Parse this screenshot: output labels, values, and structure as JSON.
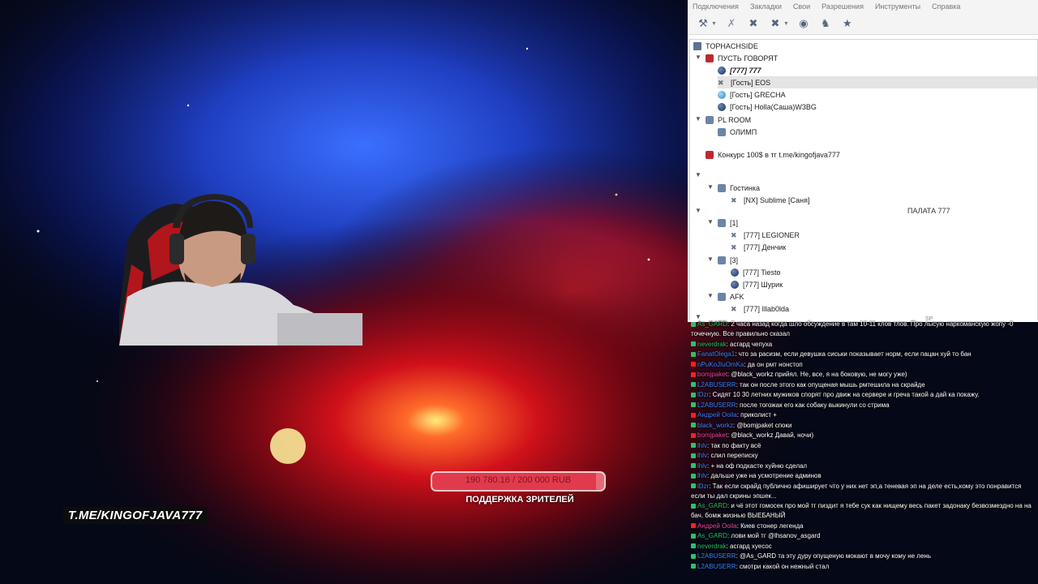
{
  "teamspeak": {
    "menu": [
      "Подключения",
      "Закладки",
      "Свои",
      "Разрешения",
      "Инструменты",
      "Справка"
    ],
    "server_name": "TOPHACHSIDE",
    "tree": [
      {
        "label": "ПУСТЬ ГОВОРЯТ",
        "type": "channel-red",
        "bold": false
      },
      {
        "label": "[777] 777",
        "type": "user",
        "bold": true
      },
      {
        "label": "[Гость] EOS",
        "type": "user-muted",
        "selected": true
      },
      {
        "label": "[Гость] GRECHA",
        "type": "user-blue"
      },
      {
        "label": "[Гость] Holla(Саша)W3BG",
        "type": "user"
      },
      {
        "label": "PL ROOM",
        "type": "channel"
      },
      {
        "label": "ОЛИМП",
        "type": "channel"
      },
      {
        "label": "Конкурс 100$ в тг t.me/kingofjava777",
        "type": "channel-red"
      },
      {
        "label": "Гостинка",
        "type": "channel"
      },
      {
        "label": "[NX] Sublime [Саня]",
        "type": "user-muted"
      },
      {
        "label": "[1]",
        "type": "channel"
      },
      {
        "label": "[777] LEGIONER",
        "type": "user-muted"
      },
      {
        "label": "[777] Денчик",
        "type": "user-muted"
      },
      {
        "label": "[3]",
        "type": "channel"
      },
      {
        "label": "[777] Tiesto",
        "type": "user"
      },
      {
        "label": "[777] Шурик",
        "type": "user"
      },
      {
        "label": "AFK",
        "type": "channel"
      },
      {
        "label": "[777] Illab0lda",
        "type": "user-muted"
      }
    ],
    "spacer_label": "ПАЛАТА 777",
    "spacer_tail": "SP"
  },
  "stream": {
    "overlay_link": "T.ME/KINGOFJAVA777",
    "donation": {
      "text": "190 780.16 / 200 000 RUB",
      "progress": 0.954,
      "caption": "ПОДДЕРЖКА ЗРИТЕЛЕЙ"
    }
  },
  "chat": [
    {
      "user": "As_GARD",
      "platform": "twitch",
      "color": "#22c55e",
      "text": "2 часа назад когда шло обсуждение в там 10-11 клов тлов. Про лысую наркоманскую жопу -0 точечную. Все правильно сказал"
    },
    {
      "user": "neverdrak",
      "platform": "twitch",
      "color": "#22c55e",
      "text": "асгард чепуха"
    },
    {
      "user": "FanatOlega1",
      "platform": "twitch",
      "color": "#3b82f6",
      "text": "что за расизм, если девушка сиськи показывает норм, если пацан хуй то бан"
    },
    {
      "user": "nPuKoJIuOmKa",
      "platform": "youtube",
      "color": "#3b82f6",
      "text": "да он рмт нонстоп"
    },
    {
      "user": "bomjpaket",
      "platform": "youtube",
      "color": "#ec4899",
      "text": "@black_workz прийял. Не, все, я на боковую, не могу уже)"
    },
    {
      "user": "L2ABUSERR",
      "platform": "twitch",
      "color": "#3b82f6",
      "text": "так он после этого как опущеная мышь рмтешила на скрайде"
    },
    {
      "user": "lDzr",
      "platform": "twitch",
      "color": "#3b82f6",
      "text": "Сидят 10 30 летних мужиков спорят про движ на сервере и греча такой а дай ка покажу."
    },
    {
      "user": "L2ABUSERR",
      "platform": "twitch",
      "color": "#3b82f6",
      "text": "после тогожак его как собаку выкинули со стрима"
    },
    {
      "user": "Андрей Ooila",
      "platform": "youtube",
      "color": "#3b82f6",
      "text": "приколист +"
    },
    {
      "user": "black_workz",
      "platform": "twitch",
      "color": "#3b82f6",
      "text": "@bomjpaket споки"
    },
    {
      "user": "bomjpaket",
      "platform": "youtube",
      "color": "#ec4899",
      "text": "@black_workz Давай, ночи)"
    },
    {
      "user": "lhlv",
      "platform": "twitch",
      "color": "#3b82f6",
      "text": "так по факту всё"
    },
    {
      "user": "lhlv",
      "platform": "twitch",
      "color": "#3b82f6",
      "text": "слил переписку"
    },
    {
      "user": "lhlv",
      "platform": "twitch",
      "color": "#3b82f6",
      "text": "+ на оф подкасте хуйню сделал"
    },
    {
      "user": "lhlv",
      "platform": "twitch",
      "color": "#3b82f6",
      "text": "дальше уже на усмотрение админов"
    },
    {
      "user": "lDzr",
      "platform": "twitch",
      "color": "#3b82f6",
      "text": "Так если скрайд публично афиширует что у них нет эп,а теневая эп на деле есть,кому это понравится если ты дал скрины эпшек..."
    },
    {
      "user": "As_GARD",
      "platform": "twitch",
      "color": "#22c55e",
      "text": "и чё этот гомосек про мой тг пиздит   я тебе сук как нищему весь пакет задонаку безвозмездно на на бач. бомж жизнью ВЫЕБАНЫЙ"
    },
    {
      "user": "Андрей Ooila",
      "platform": "youtube",
      "color": "#ec4899",
      "text": "Киев стонер легенда"
    },
    {
      "user": "As_GARD",
      "platform": "twitch",
      "color": "#22c55e",
      "text": "лови мой тг @lhsanov_asgard"
    },
    {
      "user": "neverdrak",
      "platform": "twitch",
      "color": "#22c55e",
      "text": "асгард хуесос"
    },
    {
      "user": "L2ABUSERR",
      "platform": "twitch",
      "color": "#3b82f6",
      "text": "@As_GARD та эту дуру опущеную мокают в мочу кому не лень"
    },
    {
      "user": "L2ABUSERR",
      "platform": "twitch",
      "color": "#3b82f6",
      "text": "смотри какой он нежный стал"
    }
  ]
}
